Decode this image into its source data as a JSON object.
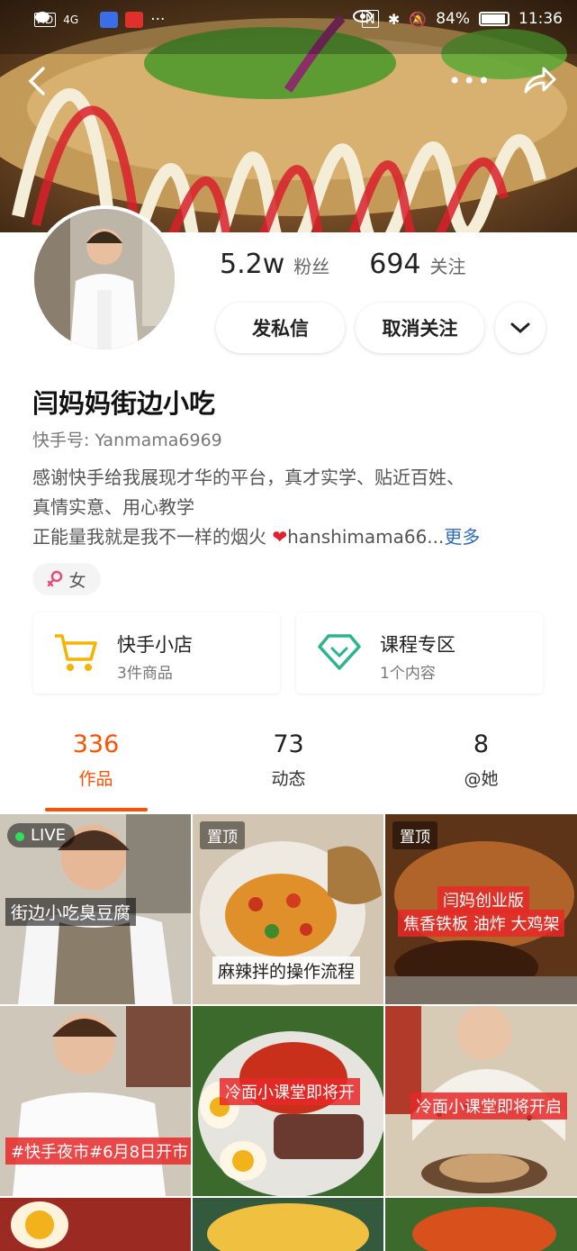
{
  "status_bar": {
    "left_icons": [
      "hd-icon",
      "4g-signal-icon",
      "wifi-icon",
      "chat-icon",
      "app-icon",
      "app-icon",
      "more-dots-icon"
    ],
    "hd": "HD",
    "network": "4G",
    "notif_more": "···",
    "battery_percent": "84%",
    "time": "11:36"
  },
  "top_nav": {
    "back_icon": "chevron-left-icon",
    "more_label": "•••",
    "share_icon": "share-icon"
  },
  "profile": {
    "followers_count": "5.2w",
    "followers_label": "粉丝",
    "following_count": "694",
    "following_label": "关注",
    "message_button": "发私信",
    "unfollow_button": "取消关注",
    "dropdown_icon": "chevron-down-icon",
    "name": "闫妈妈街边小吃",
    "kuaishou_id": "快手号: Yanmama6969",
    "bio_line1": "感谢快手给我展现才华的平台，真才实学、贴近百姓、",
    "bio_line2": "真情实意、用心教学",
    "bio_line3": "正能量我就是我不一样的烟火 ",
    "bio_heart": "❤",
    "bio_tail": "hanshimama66...",
    "bio_more": "更多",
    "gender": "女",
    "gender_icon": "female-icon"
  },
  "cards": [
    {
      "title": "快手小店",
      "sub": "3件商品",
      "icon": "cart-icon",
      "color": "#f5b400"
    },
    {
      "title": "课程专区",
      "sub": "1个内容",
      "icon": "diamond-icon",
      "color": "#2bb58f"
    }
  ],
  "tabs": [
    {
      "count": "336",
      "label": "作品",
      "active": true
    },
    {
      "count": "73",
      "label": "动态",
      "active": false
    },
    {
      "count": "8",
      "label": "@她",
      "active": false
    }
  ],
  "accent_color": "#ff5000",
  "grid": {
    "v1": {
      "live": "LIVE",
      "caption": "街边小吃臭豆腐"
    },
    "v2": {
      "pinned": "置顶",
      "caption": "麻辣拌的操作流程"
    },
    "v3": {
      "pinned": "置顶",
      "caption1": "闫妈创业版",
      "caption2": "焦香铁板 油炸 大鸡架"
    },
    "v4": {
      "caption": "#快手夜市#6月8日开市"
    },
    "v5": {
      "caption": "冷面小课堂即将开"
    },
    "v6": {
      "caption": "冷面小课堂即将开启"
    }
  }
}
